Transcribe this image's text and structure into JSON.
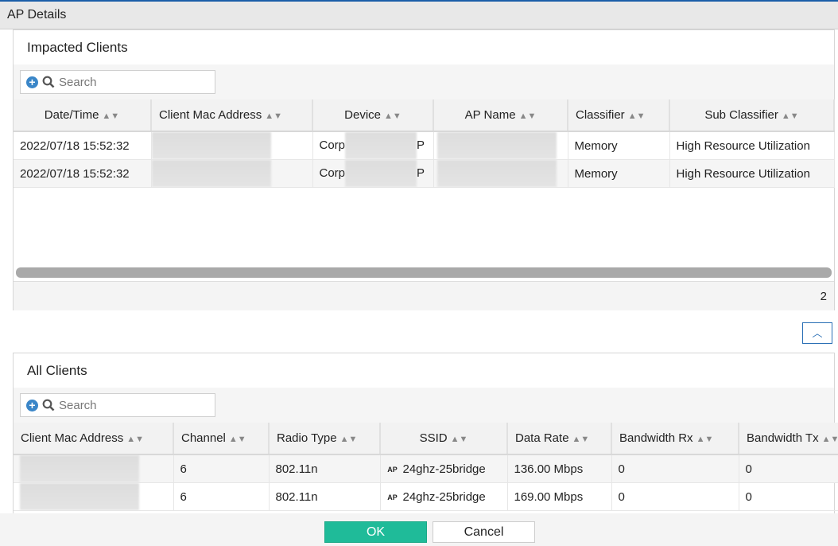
{
  "dialog": {
    "title": "AP Details"
  },
  "impacted": {
    "title": "Impacted Clients",
    "search_placeholder": "Search",
    "columns": [
      "Date/Time",
      "Client Mac Address",
      "Device",
      "AP Name",
      "Classifier",
      "Sub Classifier"
    ],
    "rows": [
      {
        "datetime": "2022/07/18 15:52:32",
        "device_prefix": "Corp",
        "device_suffix": "P",
        "classifier": "Memory",
        "sub_classifier": "High Resource Utilization"
      },
      {
        "datetime": "2022/07/18 15:52:32",
        "device_prefix": "Corp",
        "device_suffix": "P",
        "classifier": "Memory",
        "sub_classifier": "High Resource Utilization"
      }
    ],
    "count": "2"
  },
  "all": {
    "title": "All Clients",
    "search_placeholder": "Search",
    "columns": [
      "Client Mac Address",
      "Channel",
      "Radio Type",
      "SSID",
      "Data Rate",
      "Bandwidth Rx",
      "Bandwidth Tx"
    ],
    "rows": [
      {
        "channel": "6",
        "radio": "802.11n",
        "ssid": "24ghz-25bridge",
        "rate": "136.00 Mbps",
        "rx": "0",
        "tx": "0"
      },
      {
        "channel": "6",
        "radio": "802.11n",
        "ssid": "24ghz-25bridge",
        "rate": "169.00 Mbps",
        "rx": "0",
        "tx": "0"
      }
    ]
  },
  "buttons": {
    "ok": "OK",
    "cancel": "Cancel"
  },
  "icons": {
    "ap": "AP"
  }
}
